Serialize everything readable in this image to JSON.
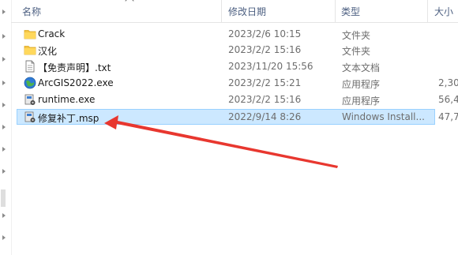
{
  "columns": {
    "name": "名称",
    "date": "修改日期",
    "type": "类型",
    "size": "大小"
  },
  "files": [
    {
      "name": "Crack",
      "date": "2023/2/6 10:15",
      "type": "文件夹",
      "size": "",
      "icon": "folder-icon"
    },
    {
      "name": "汉化",
      "date": "2023/2/2 15:16",
      "type": "文件夹",
      "size": "",
      "icon": "folder-icon"
    },
    {
      "name": "【免责声明】.txt",
      "date": "2023/11/20 15:56",
      "type": "文本文档",
      "size": "",
      "icon": "text-file-icon"
    },
    {
      "name": "ArcGIS2022.exe",
      "date": "2023/2/2 15:21",
      "type": "应用程序",
      "size": "2,30",
      "icon": "globe-app-icon"
    },
    {
      "name": "runtime.exe",
      "date": "2023/2/2 15:16",
      "type": "应用程序",
      "size": "56,4",
      "icon": "installer-icon"
    },
    {
      "name": "修复补丁.msp",
      "date": "2022/9/14 8:26",
      "type": "Windows Install...",
      "size": "47,7",
      "icon": "installer-package-icon",
      "selected": true
    }
  ],
  "annotation": {
    "arrow_color": "#e8372f"
  }
}
